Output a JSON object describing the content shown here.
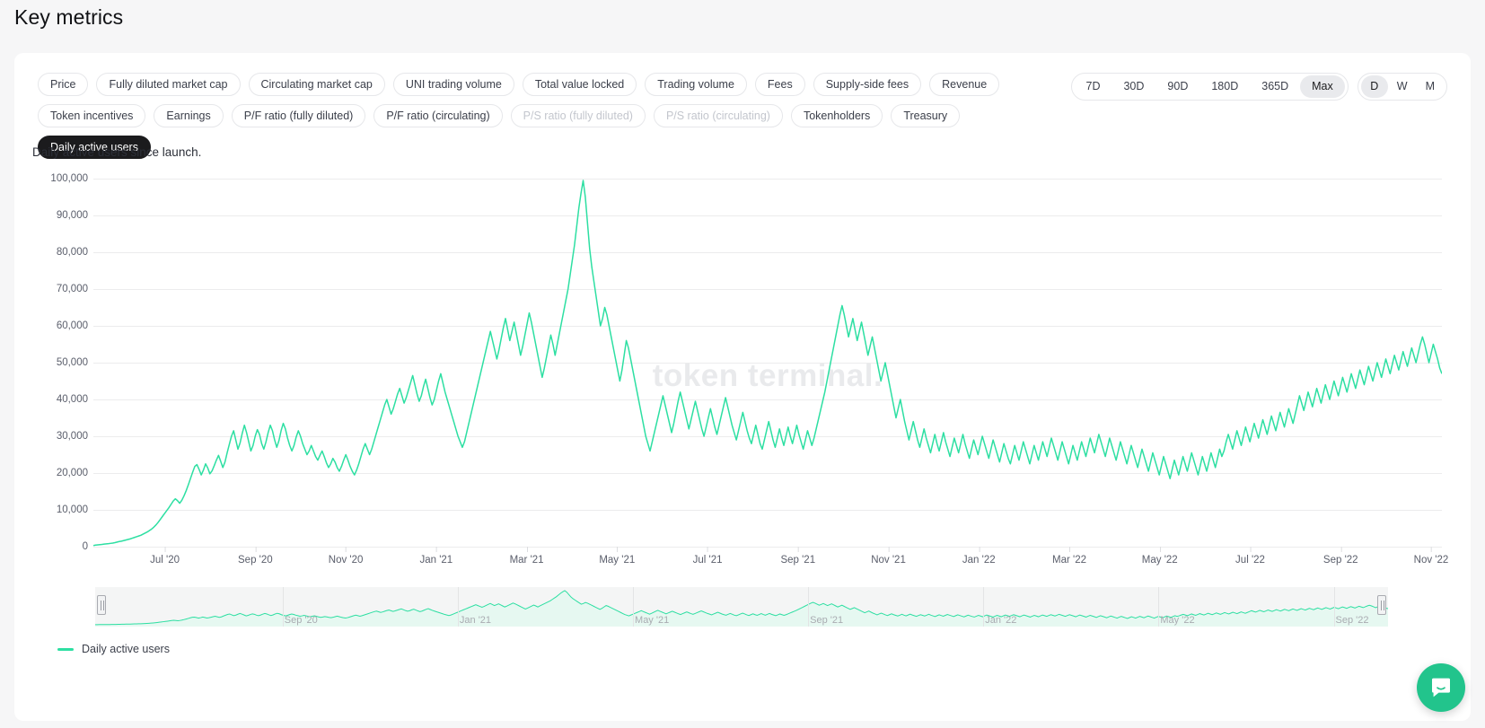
{
  "page": {
    "title": "Key metrics"
  },
  "metric_chips": [
    {
      "label": "Price",
      "state": "normal"
    },
    {
      "label": "Fully diluted market cap",
      "state": "normal"
    },
    {
      "label": "Circulating market cap",
      "state": "normal"
    },
    {
      "label": "UNI trading volume",
      "state": "normal"
    },
    {
      "label": "Total value locked",
      "state": "normal"
    },
    {
      "label": "Trading volume",
      "state": "normal"
    },
    {
      "label": "Fees",
      "state": "normal"
    },
    {
      "label": "Supply-side fees",
      "state": "normal"
    },
    {
      "label": "Revenue",
      "state": "normal"
    },
    {
      "label": "Token incentives",
      "state": "normal"
    },
    {
      "label": "Earnings",
      "state": "normal"
    },
    {
      "label": "P/F ratio (fully diluted)",
      "state": "normal"
    },
    {
      "label": "P/F ratio (circulating)",
      "state": "normal"
    },
    {
      "label": "P/S ratio (fully diluted)",
      "state": "disabled"
    },
    {
      "label": "P/S ratio (circulating)",
      "state": "disabled"
    },
    {
      "label": "Tokenholders",
      "state": "normal"
    },
    {
      "label": "Treasury",
      "state": "normal"
    },
    {
      "label": "Daily active users",
      "state": "active"
    }
  ],
  "range_selector": {
    "options": [
      "7D",
      "30D",
      "90D",
      "180D",
      "365D",
      "Max"
    ],
    "selected": "Max"
  },
  "granularity_selector": {
    "options": [
      "D",
      "W",
      "M"
    ],
    "selected": "D"
  },
  "subtitle": "Daily active users since launch.",
  "watermark": "token terminal.",
  "legend": [
    {
      "label": "Daily active users",
      "color": "#2ddfa2"
    }
  ],
  "colors": {
    "series": "#2ddfa2",
    "series_fill": "#e6f8f1",
    "active_chip_bg": "#1b1b1d",
    "grid": "#ececed",
    "intercom": "#22c48c"
  },
  "navigator": {
    "labels": [
      "Sep '20",
      "Jan '21",
      "May '21",
      "Sep '21",
      "Jan '22",
      "May '22",
      "Sep '22"
    ],
    "left_handle_pos": 0.005,
    "right_handle_pos": 0.995
  },
  "chart_data": {
    "type": "line",
    "title": "",
    "subtitle": "Daily active users since launch.",
    "xlabel": "",
    "ylabel": "",
    "ylim": [
      0,
      100000
    ],
    "ytick_values": [
      0,
      10000,
      20000,
      30000,
      40000,
      50000,
      60000,
      70000,
      80000,
      90000,
      100000
    ],
    "ytick_labels": [
      "0",
      "10,000",
      "20,000",
      "30,000",
      "40,000",
      "50,000",
      "60,000",
      "70,000",
      "80,000",
      "90,000",
      "100,000"
    ],
    "xtick_labels": [
      "Jul '20",
      "Sep '20",
      "Nov '20",
      "Jan '21",
      "Mar '21",
      "May '21",
      "Jul '21",
      "Sep '21",
      "Nov '21",
      "Jan '22",
      "Mar '22",
      "May '22",
      "Jul '22",
      "Sep '22",
      "Nov '22"
    ],
    "x_start": "2020-05-18",
    "x_end": "2022-11-22",
    "grid": true,
    "legend_position": "bottom-left",
    "series": [
      {
        "name": "Daily active users",
        "color": "#2ddfa2",
        "values": [
          300,
          420,
          500,
          560,
          610,
          700,
          760,
          820,
          900,
          980,
          1100,
          1250,
          1400,
          1500,
          1650,
          1800,
          1950,
          2100,
          2300,
          2500,
          2700,
          2900,
          3100,
          3400,
          3700,
          4000,
          4400,
          4800,
          5300,
          5900,
          6600,
          7400,
          8200,
          9000,
          9800,
          10600,
          11500,
          12400,
          13000,
          12500,
          11800,
          12600,
          13800,
          15200,
          16800,
          18500,
          20200,
          21800,
          22300,
          21000,
          19500,
          20800,
          22500,
          21400,
          19800,
          20600,
          22000,
          23500,
          24800,
          23200,
          21500,
          23000,
          25500,
          27800,
          30000,
          31500,
          29000,
          26500,
          28200,
          30800,
          33000,
          31000,
          28500,
          26000,
          27500,
          30000,
          31800,
          30500,
          28000,
          26500,
          28500,
          31000,
          33000,
          31500,
          29000,
          27000,
          28800,
          31500,
          33500,
          32000,
          29500,
          27500,
          26000,
          27500,
          29800,
          31500,
          30000,
          28000,
          26500,
          25000,
          26000,
          27500,
          26000,
          24500,
          23500,
          24800,
          26000,
          24500,
          22800,
          21500,
          22500,
          24000,
          23000,
          21500,
          20500,
          21800,
          23500,
          25000,
          23500,
          21800,
          20500,
          19500,
          20800,
          22500,
          24500,
          26500,
          28000,
          26500,
          25000,
          26500,
          28500,
          30500,
          32500,
          34500,
          36500,
          38500,
          40000,
          38000,
          36000,
          37500,
          39500,
          41500,
          43000,
          41000,
          39000,
          40500,
          42500,
          44500,
          46500,
          44000,
          41500,
          39500,
          41000,
          43500,
          45500,
          43000,
          40500,
          38500,
          40000,
          42500,
          45000,
          47000,
          44500,
          42000,
          40000,
          38000,
          36000,
          34000,
          32000,
          30000,
          28500,
          27000,
          28500,
          31000,
          33500,
          36000,
          38500,
          41000,
          43500,
          46000,
          48500,
          51000,
          53500,
          56000,
          58500,
          56000,
          53500,
          51000,
          53500,
          56500,
          59500,
          62000,
          59000,
          56000,
          58500,
          61000,
          58000,
          55000,
          52000,
          54500,
          57500,
          60500,
          63500,
          61000,
          58000,
          55000,
          52000,
          49000,
          46000,
          48500,
          51500,
          54500,
          57500,
          55000,
          52000,
          55000,
          58000,
          61000,
          64000,
          67000,
          70000,
          74000,
          78000,
          82000,
          87000,
          92000,
          96000,
          99500,
          95000,
          88000,
          81000,
          76000,
          72000,
          68000,
          64000,
          60000,
          62000,
          65000,
          63000,
          60000,
          57000,
          54000,
          51000,
          48000,
          45000,
          48000,
          52000,
          56000,
          54000,
          51000,
          48000,
          45000,
          42000,
          39000,
          36000,
          33000,
          30000,
          28000,
          26000,
          28500,
          31000,
          33500,
          36000,
          38500,
          41000,
          38500,
          36000,
          33500,
          31000,
          33500,
          36500,
          39500,
          42000,
          39500,
          37000,
          34500,
          32000,
          34500,
          37000,
          39500,
          37000,
          34500,
          32000,
          30000,
          32500,
          35000,
          37500,
          35000,
          32500,
          30500,
          33000,
          35500,
          38000,
          40500,
          38000,
          35500,
          33000,
          31000,
          29000,
          31500,
          34000,
          36500,
          34000,
          31500,
          29500,
          28000,
          30500,
          33000,
          30500,
          28000,
          26500,
          29000,
          31500,
          34000,
          31500,
          29000,
          27000,
          29500,
          32000,
          29500,
          27500,
          30000,
          32500,
          30000,
          28000,
          30500,
          33000,
          30500,
          28500,
          26500,
          29000,
          31500,
          29500,
          27500,
          29500,
          32000,
          34500,
          37000,
          39500,
          42000,
          45000,
          48000,
          51000,
          54000,
          57000,
          60000,
          63000,
          65500,
          63000,
          60000,
          57000,
          59500,
          62000,
          59000,
          56000,
          58500,
          61000,
          58000,
          55000,
          52000,
          54500,
          57000,
          54000,
          51000,
          48000,
          45000,
          47500,
          50000,
          47000,
          44000,
          41000,
          38000,
          35000,
          37500,
          40000,
          37000,
          34000,
          31500,
          29000,
          31500,
          34000,
          31500,
          29000,
          27000,
          29500,
          32000,
          29500,
          27500,
          25500,
          28000,
          30500,
          28000,
          26000,
          28500,
          31000,
          28500,
          26500,
          24500,
          27000,
          29500,
          27500,
          25500,
          28000,
          30500,
          28000,
          26000,
          24000,
          26500,
          29000,
          27000,
          25000,
          27500,
          30000,
          28000,
          26000,
          24000,
          26500,
          29000,
          27000,
          25000,
          23000,
          25500,
          28000,
          26000,
          24000,
          22500,
          25000,
          27500,
          25500,
          23500,
          26000,
          28500,
          26500,
          24500,
          22500,
          25000,
          27500,
          25500,
          23500,
          26000,
          28500,
          26500,
          24500,
          27000,
          29500,
          27500,
          25500,
          23500,
          26000,
          28500,
          26500,
          24500,
          22500,
          25000,
          27500,
          25500,
          23500,
          26000,
          28500,
          26500,
          24500,
          27000,
          29500,
          27500,
          25500,
          28000,
          30500,
          28500,
          26500,
          24500,
          27000,
          29500,
          27500,
          25500,
          23500,
          26000,
          28500,
          26500,
          24500,
          22500,
          25000,
          27500,
          25500,
          23500,
          21500,
          24000,
          26500,
          24500,
          22500,
          20500,
          23000,
          25500,
          23500,
          21500,
          19500,
          22000,
          24500,
          22500,
          20500,
          18500,
          21000,
          23500,
          21500,
          19500,
          22000,
          24500,
          22500,
          20500,
          23000,
          25500,
          23500,
          21500,
          19500,
          22000,
          24500,
          22500,
          20500,
          23000,
          25500,
          23500,
          21500,
          24000,
          26500,
          24500,
          26000,
          28500,
          30500,
          28500,
          26500,
          29000,
          31500,
          29500,
          27500,
          30000,
          32500,
          30500,
          28500,
          31000,
          33500,
          31500,
          29500,
          32000,
          34500,
          32500,
          30500,
          33000,
          35500,
          33500,
          31500,
          34000,
          36500,
          34500,
          32500,
          35000,
          37500,
          35500,
          33500,
          36000,
          38500,
          41000,
          39000,
          37000,
          39500,
          42000,
          40000,
          38000,
          40500,
          43000,
          41000,
          39000,
          41500,
          44000,
          42000,
          40000,
          42500,
          45000,
          43000,
          41000,
          43500,
          46000,
          44000,
          42000,
          44500,
          47000,
          45000,
          43000,
          45500,
          48000,
          46000,
          44000,
          46500,
          49000,
          47000,
          45000,
          47500,
          50000,
          48000,
          46000,
          48500,
          51000,
          49000,
          47000,
          49500,
          52000,
          50000,
          48000,
          50500,
          53000,
          51000,
          49000,
          51500,
          54000,
          52000,
          50000,
          52500,
          55000,
          57000,
          55000,
          52500,
          50000,
          52500,
          55000,
          53000,
          51000,
          48500,
          47000
        ]
      }
    ]
  }
}
